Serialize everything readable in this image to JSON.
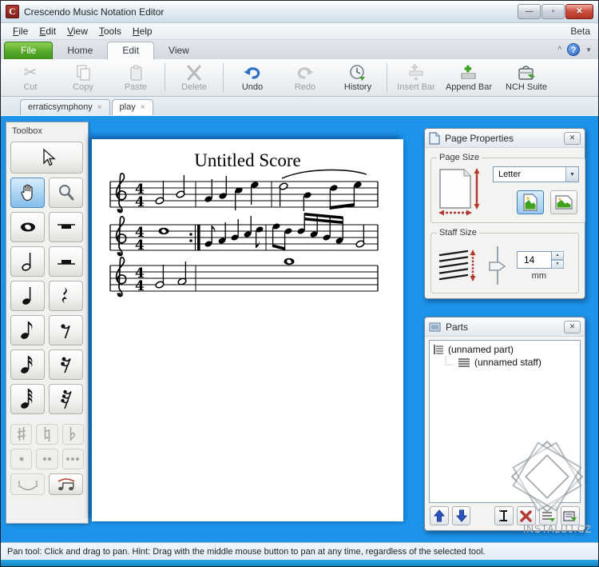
{
  "window": {
    "title": "Crescendo Music Notation Editor"
  },
  "icons": {
    "minimize": "—",
    "maximize": "▫",
    "close": "✕",
    "collapse": "^",
    "help": "?",
    "dropdown": "▼",
    "tab_close": "×",
    "spin_up": "▲",
    "spin_down": "▼"
  },
  "menubar": {
    "items": [
      {
        "label": "File"
      },
      {
        "label": "Edit"
      },
      {
        "label": "View"
      },
      {
        "label": "Tools"
      },
      {
        "label": "Help"
      }
    ],
    "right_label": "Beta"
  },
  "ribbon": {
    "tabs": [
      {
        "label": "File"
      },
      {
        "label": "Home"
      },
      {
        "label": "Edit"
      },
      {
        "label": "View"
      }
    ]
  },
  "toolbar": {
    "buttons": [
      {
        "label": "Cut"
      },
      {
        "label": "Copy"
      },
      {
        "label": "Paste"
      },
      {
        "label": "Delete"
      },
      {
        "label": "Undo"
      },
      {
        "label": "Redo"
      },
      {
        "label": "History"
      },
      {
        "label": "Insert Bar"
      },
      {
        "label": "Append Bar"
      },
      {
        "label": "NCH Suite"
      }
    ]
  },
  "doc_tabs": [
    {
      "label": "erraticsymphony"
    },
    {
      "label": "play"
    }
  ],
  "toolbox": {
    "title": "Toolbox"
  },
  "score": {
    "title": "Untitled Score",
    "time_signature_top": "4",
    "time_signature_bottom": "4"
  },
  "page_properties": {
    "title": "Page Properties",
    "page_size_label": "Page Size",
    "page_size_value": "Letter",
    "staff_size_label": "Staff Size",
    "staff_size_value": "14",
    "staff_size_unit": "mm"
  },
  "parts": {
    "title": "Parts",
    "tree": [
      {
        "label": "(unnamed part)"
      },
      {
        "label": "(unnamed staff)"
      }
    ]
  },
  "status_bar": {
    "text": "Pan tool: Click and drag to pan. Hint: Drag with the middle mouse button to pan at any time, regardless of the selected tool."
  },
  "watermark": {
    "text": "INSTALUJ.CZ"
  },
  "colors": {
    "canvas_blue": "#1d93e9",
    "file_tab_green": "#57a829",
    "accent_selection": "#84bdea",
    "close_red": "#b03424"
  }
}
